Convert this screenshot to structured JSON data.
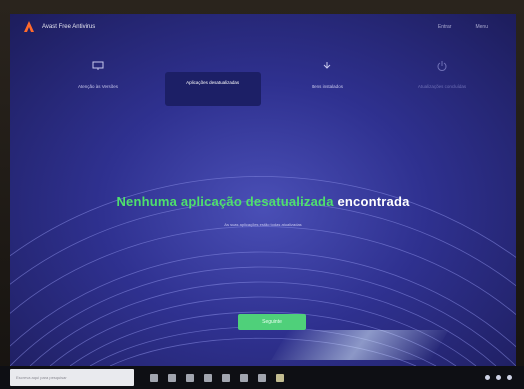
{
  "app": {
    "title": "Avast Free Antivirus",
    "header_links": [
      "Entrar",
      "Menu"
    ]
  },
  "tabs": [
    {
      "label": "Atenção às Versões",
      "icon": "monitor-icon",
      "state": "normal"
    },
    {
      "label": "Aplicações desatualizadas",
      "icon": "refresh-icon",
      "state": "active"
    },
    {
      "label": "Itens instalados",
      "icon": "download-icon",
      "state": "normal"
    },
    {
      "label": "Atualizações concluídas",
      "icon": "power-icon",
      "state": "dim"
    }
  ],
  "main": {
    "headline_green": "Nenhuma aplicação desatualizada",
    "headline_white": "encontrada",
    "subtext": "As suas aplicações estão todas atualizadas",
    "button_label": "Seguinte"
  },
  "taskbar": {
    "search_placeholder": "Escreva aqui para pesquisar"
  },
  "colors": {
    "accent_green": "#4fe06c",
    "background_blue": "#2f3190",
    "active_tab": "#1c1f66"
  }
}
